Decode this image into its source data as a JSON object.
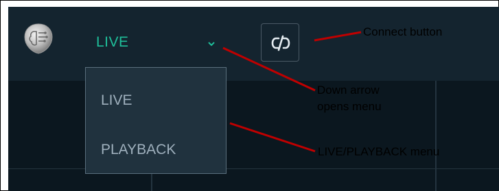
{
  "topbar": {
    "mode_label": "LIVE",
    "logo_icon": "brain-chip-logo-icon",
    "chevron_icon": "chevron-down-icon",
    "connect_icon": "unlink-icon"
  },
  "mode_menu": {
    "items": [
      {
        "label": "LIVE"
      },
      {
        "label": "PLAYBACK"
      }
    ]
  },
  "annotations": {
    "connect": "Connect button",
    "down_arrow_line1": "Down arrow",
    "down_arrow_line2": "opens menu",
    "menu": "LIVE/PLAYBACK menu"
  },
  "colors": {
    "accent": "#1fbf9a",
    "annotation_line": "#c00000",
    "panel_bg": "#0b171f",
    "topbar_bg": "#14242f",
    "menu_bg": "#20323e"
  }
}
